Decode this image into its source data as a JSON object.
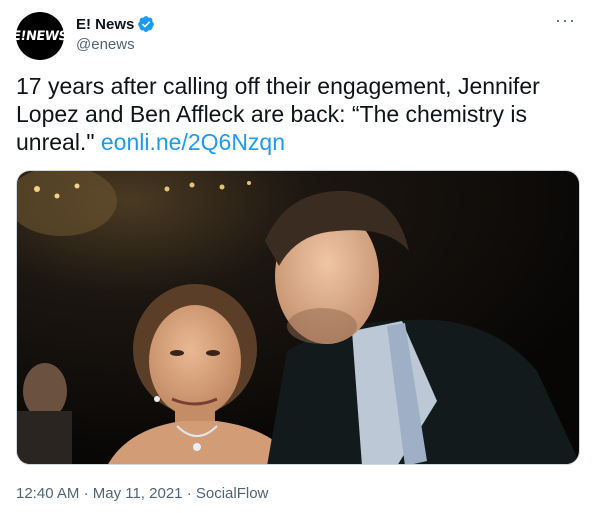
{
  "author": {
    "display_name": "E! News",
    "handle": "@enews",
    "avatar_text": "E!NEWS",
    "verified": true
  },
  "more_label": "···",
  "tweet": {
    "text": "17 years after calling off their engagement, Jennifer Lopez and Ben Affleck are back: “The chemistry is unreal.\" ",
    "link": "eonli.ne/2Q6Nzqn"
  },
  "media": {
    "alt": "Photo of Jennifer Lopez and Ben Affleck at an event"
  },
  "meta": {
    "time": "12:40 AM",
    "separator": "·",
    "date": "May 11, 2021",
    "source": "SocialFlow"
  },
  "colors": {
    "link": "#1d9bf0",
    "verified": "#1d9bf0",
    "text": "#0f1419",
    "muted": "#536471"
  },
  "icons": [
    "verified-badge-icon",
    "more-icon"
  ]
}
